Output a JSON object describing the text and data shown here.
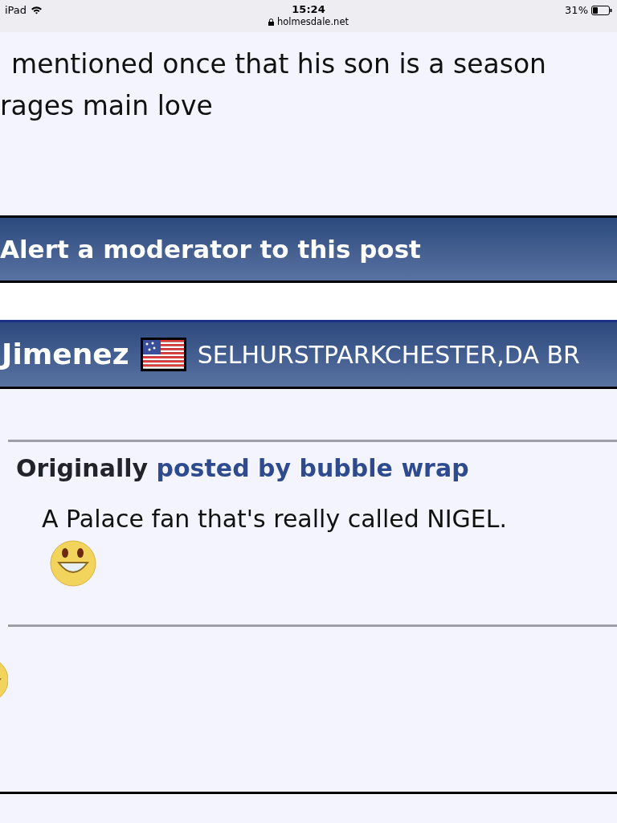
{
  "status_bar": {
    "device": "iPad",
    "time": "15:24",
    "url": "holmesdale.net",
    "battery": "31%"
  },
  "post_text_lines": [
    "mentioned once that his son is a season",
    "rages main love"
  ],
  "alert_bar": {
    "label": "Alert a moderator to this post"
  },
  "post_header": {
    "username": "Jimenez",
    "location": "SELHURSTPARKCHESTER,DA BR"
  },
  "quote": {
    "prefix": "Originally",
    "author_link": "posted by bubble wrap",
    "text": "A Palace fan that's really called NIGEL."
  }
}
